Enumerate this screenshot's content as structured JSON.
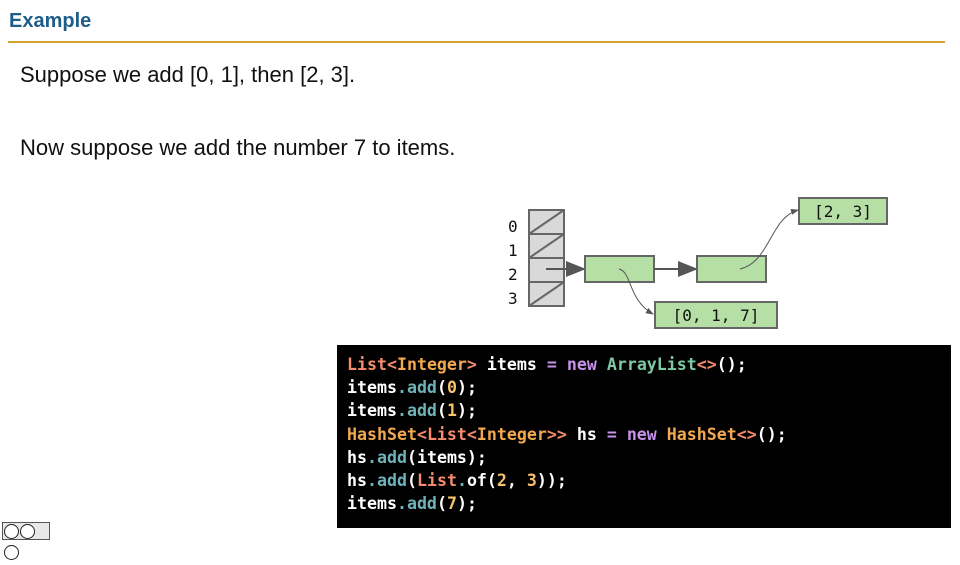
{
  "slide": {
    "title": "Example",
    "line1": "Suppose we add [0, 1], then [2, 3].",
    "line2": "Now suppose we add the number 7 to items."
  },
  "diagram": {
    "indices": [
      "0",
      "1",
      "2",
      "3"
    ],
    "list_a": "[0, 1, 7]",
    "list_b": "[2, 3]"
  },
  "code": {
    "lines": [
      "List<Integer> items = new ArrayList<>();",
      "items.add(0);",
      "items.add(1);",
      "HashSet<List<Integer>> hs = new HashSet<>();",
      "hs.add(items);",
      "hs.add(List.of(2, 3));",
      "items.add(7);"
    ]
  },
  "footer": {
    "license_icon": "cc-by-nc-sa-icon"
  }
}
